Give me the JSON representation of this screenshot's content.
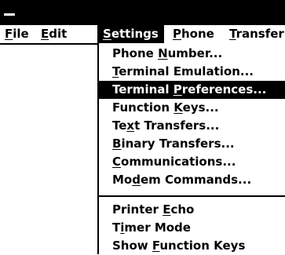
{
  "window": {
    "system_menu_icon": "system-menu-dash"
  },
  "menubar": {
    "items": [
      {
        "pre": "",
        "acc": "F",
        "post": "ile"
      },
      {
        "pre": "",
        "acc": "E",
        "post": "dit"
      },
      {
        "pre": "",
        "acc": "S",
        "post": "ettings"
      },
      {
        "pre": "",
        "acc": "P",
        "post": "hone"
      },
      {
        "pre": "",
        "acc": "T",
        "post": "ransfer"
      }
    ],
    "selected": "Settings"
  },
  "settings_menu": {
    "items": [
      {
        "pre": "Phone ",
        "acc": "N",
        "post": "umber..."
      },
      {
        "pre": "",
        "acc": "T",
        "post": "erminal Emulation..."
      },
      {
        "pre": "Terminal ",
        "acc": "P",
        "post": "references..."
      },
      {
        "pre": "Function ",
        "acc": "K",
        "post": "eys..."
      },
      {
        "pre": "Te",
        "acc": "x",
        "post": "t Transfers..."
      },
      {
        "pre": "",
        "acc": "B",
        "post": "inary Transfers..."
      },
      {
        "pre": "",
        "acc": "C",
        "post": "ommunications..."
      },
      {
        "pre": "Mo",
        "acc": "d",
        "post": "em Commands..."
      },
      {
        "pre": "Printer ",
        "acc": "E",
        "post": "cho"
      },
      {
        "pre": "T",
        "acc": "i",
        "post": "mer Mode"
      },
      {
        "pre": "Show ",
        "acc": "F",
        "post": "unction Keys"
      }
    ],
    "highlighted": "Terminal Preferences..."
  },
  "colors": {
    "foreground": "#000000",
    "background": "#ffffff",
    "highlight": "#000000"
  }
}
